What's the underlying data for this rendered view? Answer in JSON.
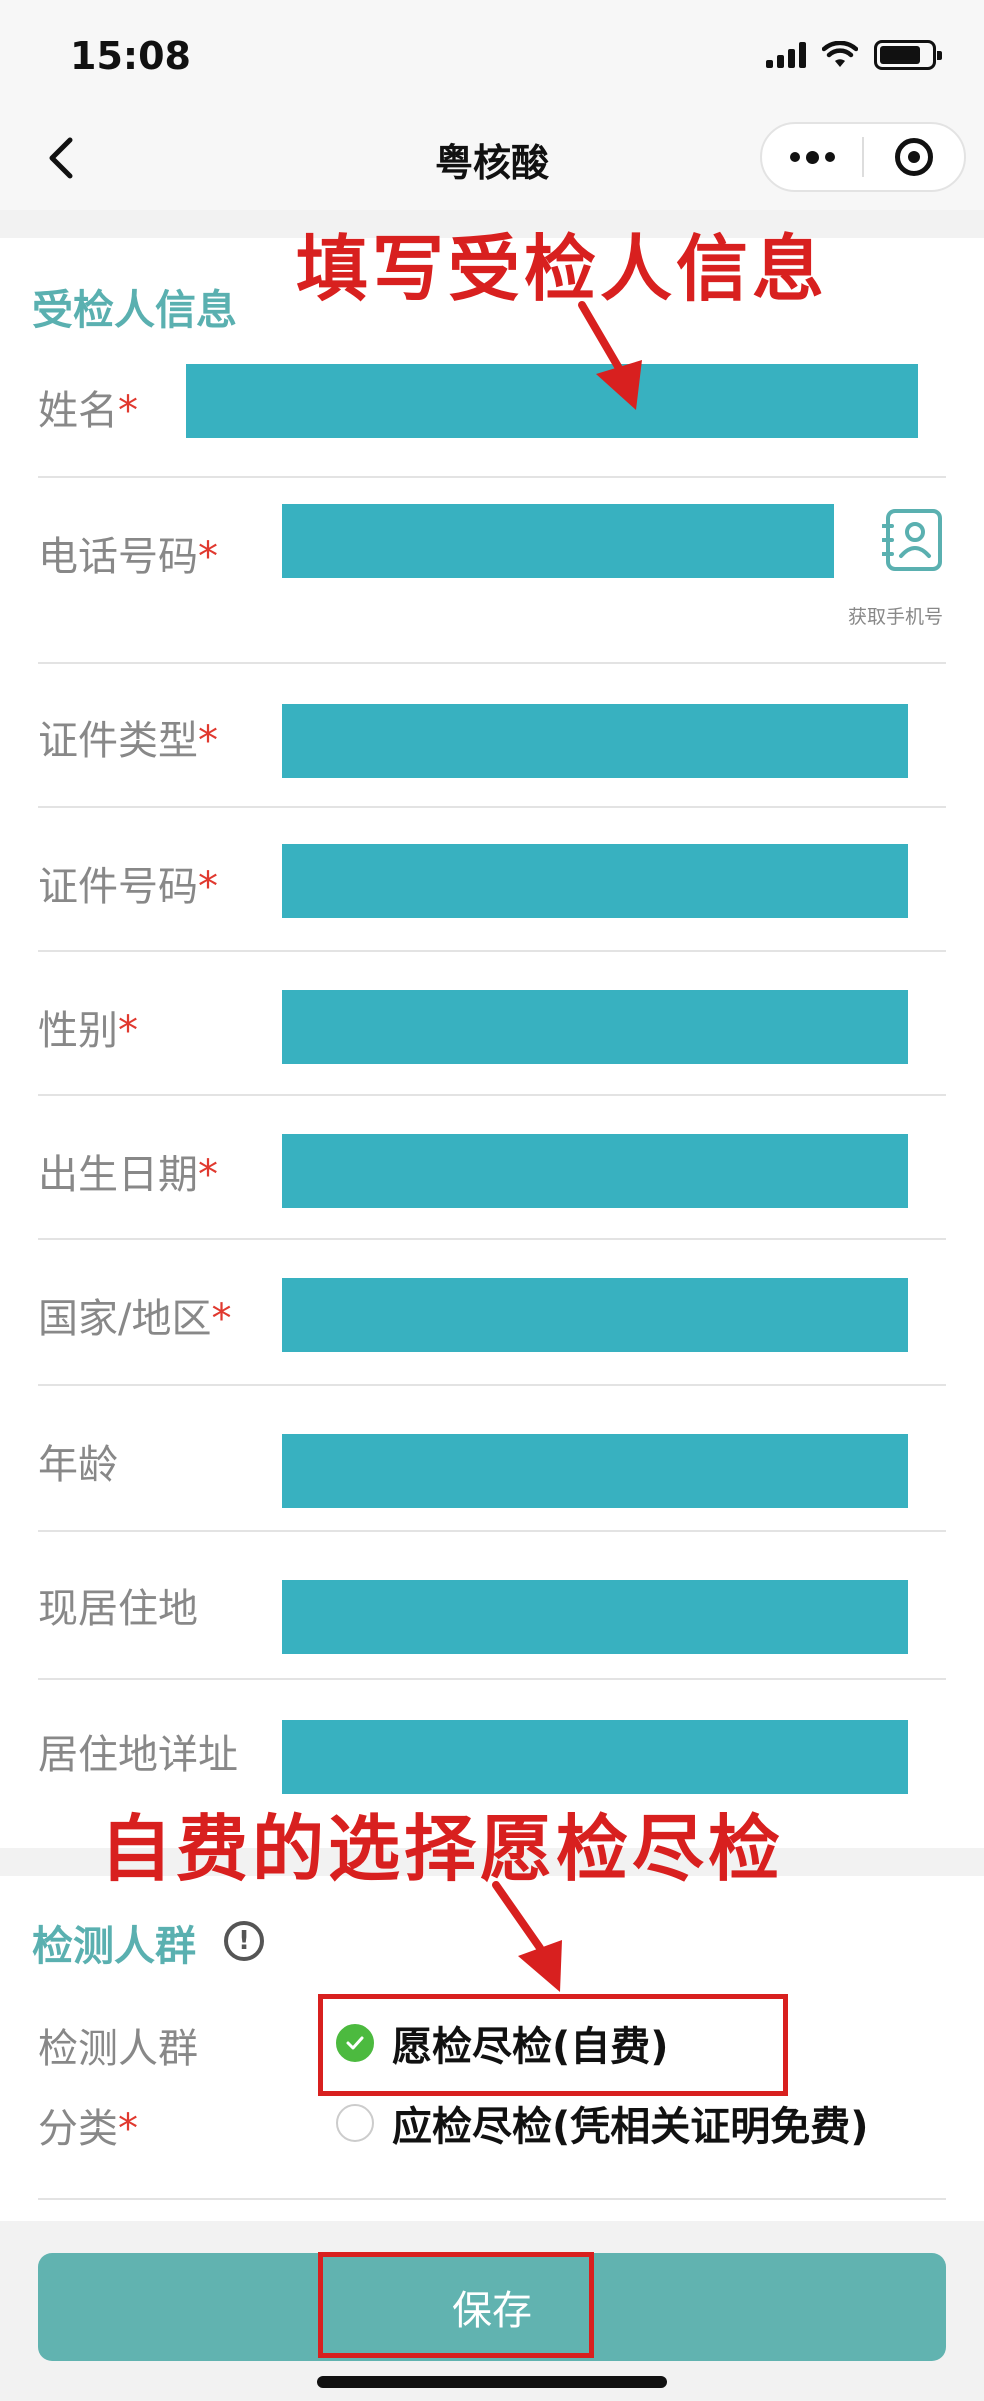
{
  "status_bar": {
    "time": "15:08"
  },
  "nav": {
    "title": "粤核酸"
  },
  "form": {
    "section_title": "受检人信息",
    "fields": [
      {
        "label": "姓名",
        "required": "*"
      },
      {
        "label": "电话号码",
        "required": "*"
      },
      {
        "label": "证件类型",
        "required": "*"
      },
      {
        "label": "证件号码",
        "required": "*"
      },
      {
        "label": "性别",
        "required": "*"
      },
      {
        "label": "出生日期",
        "required": "*"
      },
      {
        "label": "国家/地区",
        "required": "*"
      },
      {
        "label": "年龄",
        "required": ""
      },
      {
        "label": "现居住地",
        "required": ""
      },
      {
        "label": "居住地详址",
        "required": ""
      }
    ],
    "get_phone_caption": "获取手机号"
  },
  "annotations": {
    "top": "填写受检人信息",
    "middle": "自费的选择愿检尽检"
  },
  "detection": {
    "section_title": "检测人群",
    "label_line1": "检测人群",
    "label_line2": "分类",
    "required": "*",
    "options": [
      {
        "label": "愿检尽检(自费)",
        "checked": true
      },
      {
        "label": "应检尽检(凭相关证明免费)",
        "checked": false
      }
    ]
  },
  "bottom": {
    "save_label": "保存"
  },
  "colors": {
    "accent": "#5ab0b0",
    "field": "#38b1c0",
    "annotation": "#d8201f",
    "radio_checked": "#4cba3f",
    "save": "#61b3b0"
  }
}
